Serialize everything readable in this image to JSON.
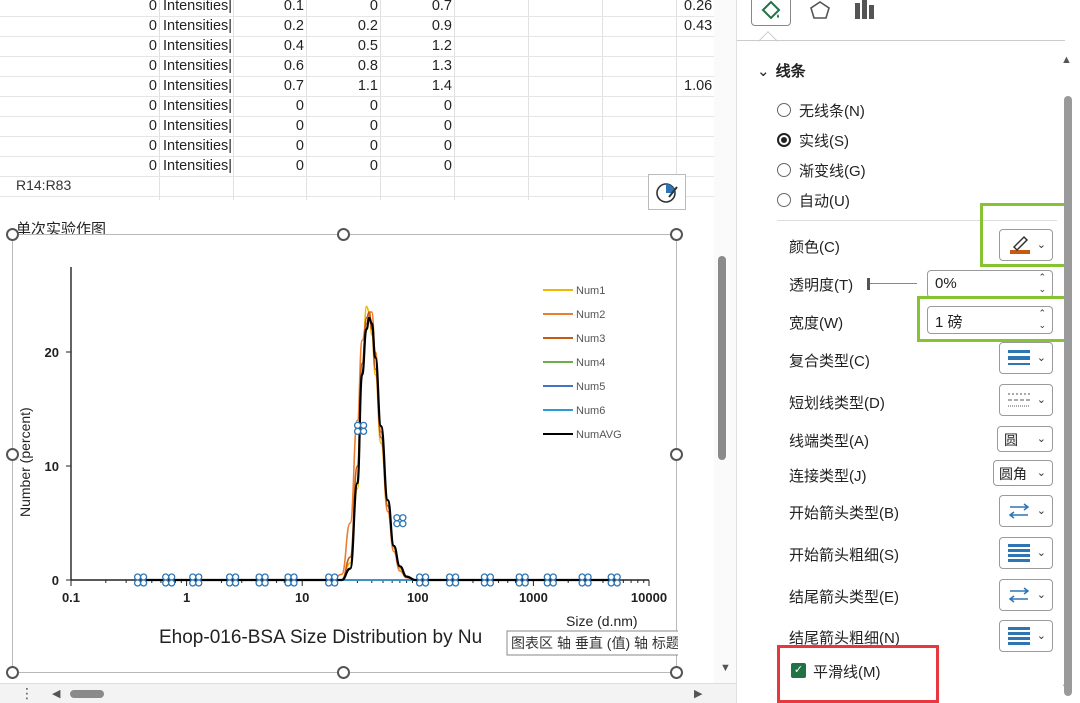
{
  "sheet": {
    "rows": [
      [
        "0",
        "Intensities|",
        "0.1",
        "0",
        "0.7",
        "0.26"
      ],
      [
        "0",
        "Intensities|",
        "0.2",
        "0.2",
        "0.9",
        "0.43"
      ],
      [
        "0",
        "Intensities|",
        "0.4",
        "0.5",
        "1.2",
        ""
      ],
      [
        "0",
        "Intensities|",
        "0.6",
        "0.8",
        "1.3",
        ""
      ],
      [
        "0",
        "Intensities|",
        "0.7",
        "1.1",
        "1.4",
        "1.06"
      ],
      [
        "0",
        "Intensities|",
        "0",
        "0",
        "0",
        ""
      ],
      [
        "0",
        "Intensities|",
        "0",
        "0",
        "0",
        ""
      ],
      [
        "0",
        "Intensities|",
        "0",
        "0",
        "0",
        ""
      ],
      [
        "0",
        "Intensities|",
        "0",
        "0",
        "0",
        ""
      ]
    ],
    "name_box": "R14:R83",
    "chart_title_cell": "单次实验作图"
  },
  "chart": {
    "title_visible": "Ehop-016-BSA Size Distribution by Nu",
    "tooltip_left": "图表区",
    "tooltip_right": "轴 垂直 (值) 轴 标题",
    "xlabel": "Size (d.nm)",
    "ylabel": "Number (percent)",
    "xtick_labels": [
      "0.1",
      "1",
      "10",
      "100",
      "1000",
      "10000"
    ],
    "ytick_labels": [
      "0",
      "10",
      "20"
    ],
    "legend": [
      "Num1",
      "Num2",
      "Num3",
      "Num4",
      "Num5",
      "Num6",
      "NumAVG"
    ]
  },
  "chart_data": {
    "type": "line",
    "title": "Ehop-016-BSA Size Distribution by Nu",
    "xlabel": "Size (d.nm)",
    "ylabel": "Number (percent)",
    "xscale": "log",
    "xlim": [
      0.1,
      10000
    ],
    "ylim": [
      0,
      25
    ],
    "x": [
      0.4,
      0.7,
      1.2,
      2.5,
      4.5,
      8,
      18,
      22,
      26,
      30,
      33,
      36,
      38,
      40,
      43,
      48,
      55,
      62,
      70,
      80,
      95,
      120,
      250,
      480,
      900,
      1600,
      3000,
      5500
    ],
    "series": [
      {
        "name": "Num1",
        "color": "#f2b800",
        "values": [
          0,
          0,
          0,
          0,
          0,
          0,
          0,
          0,
          1.5,
          8,
          18,
          24,
          23.5,
          21.5,
          18,
          12,
          6,
          2.8,
          1,
          0.3,
          0,
          0,
          0,
          0,
          0,
          0,
          0,
          0
        ]
      },
      {
        "name": "Num2",
        "color": "#ed7d31",
        "values": [
          0,
          0,
          0,
          0,
          0,
          0,
          0,
          0.5,
          5,
          14,
          21,
          22.5,
          23.5,
          23.5,
          20,
          13,
          6,
          2.5,
          0.8,
          0.2,
          0,
          0,
          0,
          0,
          0,
          0,
          0,
          0
        ]
      },
      {
        "name": "Num3",
        "color": "#c55a11",
        "values": [
          0,
          0,
          0,
          0,
          0,
          0,
          0,
          0,
          2,
          10,
          19,
          23,
          23.5,
          22,
          18.5,
          12.5,
          6.5,
          3,
          1.2,
          0.3,
          0,
          0,
          0,
          0,
          0,
          0,
          0,
          0
        ]
      },
      {
        "name": "Num4",
        "color": "#70ad47",
        "values": [
          0,
          0,
          0,
          0,
          0,
          0,
          0,
          0,
          0,
          0,
          0,
          0,
          0,
          0,
          0,
          0,
          0,
          0,
          0,
          0,
          0,
          0,
          0,
          0,
          0,
          0,
          0,
          0
        ]
      },
      {
        "name": "Num5",
        "color": "#4472c4",
        "values": [
          0,
          0,
          0,
          0,
          0,
          0,
          0,
          0,
          0,
          0,
          0,
          0,
          0,
          0,
          0,
          0,
          0,
          0,
          0,
          0,
          0,
          0,
          0,
          0,
          0,
          0,
          0,
          0
        ]
      },
      {
        "name": "Num6",
        "color": "#2e9bd6",
        "values": [
          0,
          0,
          0,
          0,
          0,
          0,
          0,
          0,
          0,
          0,
          0,
          0,
          0,
          0,
          0,
          0,
          0,
          0,
          0,
          0,
          0,
          0,
          0,
          0,
          0,
          0,
          0,
          0
        ]
      },
      {
        "name": "NumAVG",
        "color": "#000000",
        "values": [
          0,
          0,
          0,
          0,
          0,
          0,
          0,
          0,
          1,
          8.5,
          18,
          22,
          23,
          22.5,
          19.5,
          13.5,
          7,
          3,
          1.2,
          0.3,
          0,
          0,
          0,
          0,
          0,
          0,
          0,
          0
        ]
      }
    ],
    "selected_points_x": [
      0.4,
      0.7,
      1.2,
      2.5,
      4.5,
      8,
      18,
      32,
      70,
      110,
      200,
      400,
      800,
      1400,
      2800,
      5000
    ],
    "selected_points_y": [
      0,
      0,
      0,
      0,
      0,
      0,
      0,
      13.3,
      5.2,
      0,
      0,
      0,
      0,
      0,
      0,
      0
    ],
    "legend_position": "top-right"
  },
  "pane": {
    "section": "线条",
    "radios": [
      {
        "label": "无线条(N)",
        "checked": false
      },
      {
        "label": "实线(S)",
        "checked": true
      },
      {
        "label": "渐变线(G)",
        "checked": false
      },
      {
        "label": "自动(U)",
        "checked": false
      }
    ],
    "props": {
      "color": "颜色(C)",
      "transparency": "透明度(T)",
      "transparency_value": "0%",
      "width": "宽度(W)",
      "width_value": "1 磅",
      "compound": "复合类型(C)",
      "dash": "短划线类型(D)",
      "cap": "线端类型(A)",
      "cap_value": "圆",
      "join": "连接类型(J)",
      "join_value": "圆角",
      "begin_arrow_type": "开始箭头类型(B)",
      "begin_arrow_size": "开始箭头粗细(S)",
      "end_arrow_type": "结尾箭头类型(E)",
      "end_arrow_size": "结尾箭头粗细(N)",
      "smooth": "平滑线(M)"
    },
    "colors": {
      "accent": "#217346",
      "highlight_green": "#86c232",
      "highlight_red": "#e6383e",
      "line_color_swatch": "#c55a11"
    }
  }
}
